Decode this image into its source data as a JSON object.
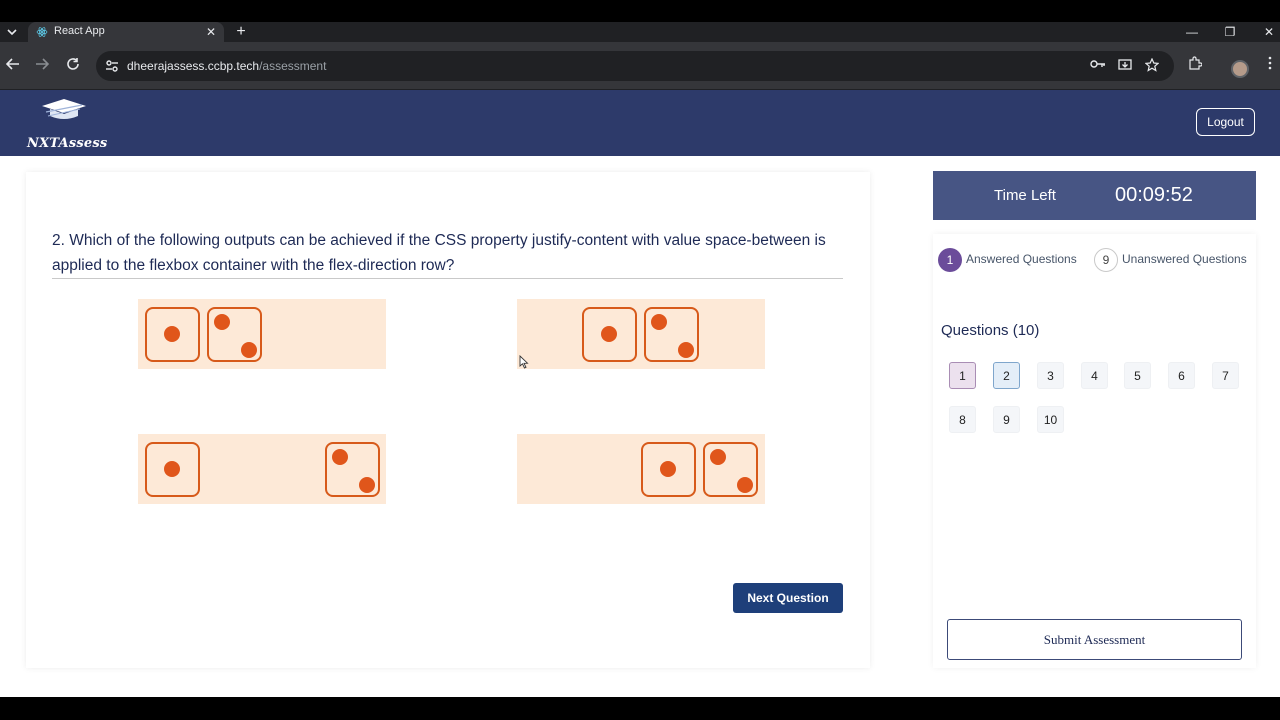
{
  "browser": {
    "tab_title": "React App",
    "tab_close": "✕",
    "new_tab": "+",
    "url_host": "dheerajassess.ccbp.tech",
    "url_path": "/assessment",
    "window_controls": [
      "—",
      "❐",
      "✕"
    ]
  },
  "header": {
    "logo_text": "NXTAssess",
    "logout_label": "Logout"
  },
  "question": {
    "text": "2. Which of the following outputs can be achieved if the CSS property justify-content with value space-between is applied to the flexbox container with the flex-direction row?",
    "options": [
      {
        "id": "option-1",
        "arrangement": "flex-start"
      },
      {
        "id": "option-2",
        "arrangement": "center"
      },
      {
        "id": "option-3",
        "arrangement": "space-between"
      },
      {
        "id": "option-4",
        "arrangement": "flex-end"
      }
    ],
    "next_label": "Next Question"
  },
  "timer": {
    "label": "Time Left",
    "value": "00:09:52"
  },
  "summary": {
    "answered_count": "1",
    "answered_label": "Answered Questions",
    "unanswered_count": "9",
    "unanswered_label": "Unanswered Questions"
  },
  "questions_panel": {
    "heading": "Questions (10)",
    "numbers": [
      {
        "label": "1",
        "state": "answered"
      },
      {
        "label": "2",
        "state": "current"
      },
      {
        "label": "3",
        "state": "unanswered"
      },
      {
        "label": "4",
        "state": "unanswered"
      },
      {
        "label": "5",
        "state": "unanswered"
      },
      {
        "label": "6",
        "state": "unanswered"
      },
      {
        "label": "7",
        "state": "unanswered"
      },
      {
        "label": "8",
        "state": "unanswered"
      },
      {
        "label": "9",
        "state": "unanswered"
      },
      {
        "label": "10",
        "state": "unanswered"
      }
    ],
    "submit_label": "Submit Assessment"
  },
  "colors": {
    "header_bg": "#2d3a6a",
    "timer_bg": "#475584",
    "option_bg": "#fde9d7",
    "dice_color": "#d75a1a",
    "answered_badge": "#6b4c9a",
    "next_button": "#1e3f7a"
  }
}
